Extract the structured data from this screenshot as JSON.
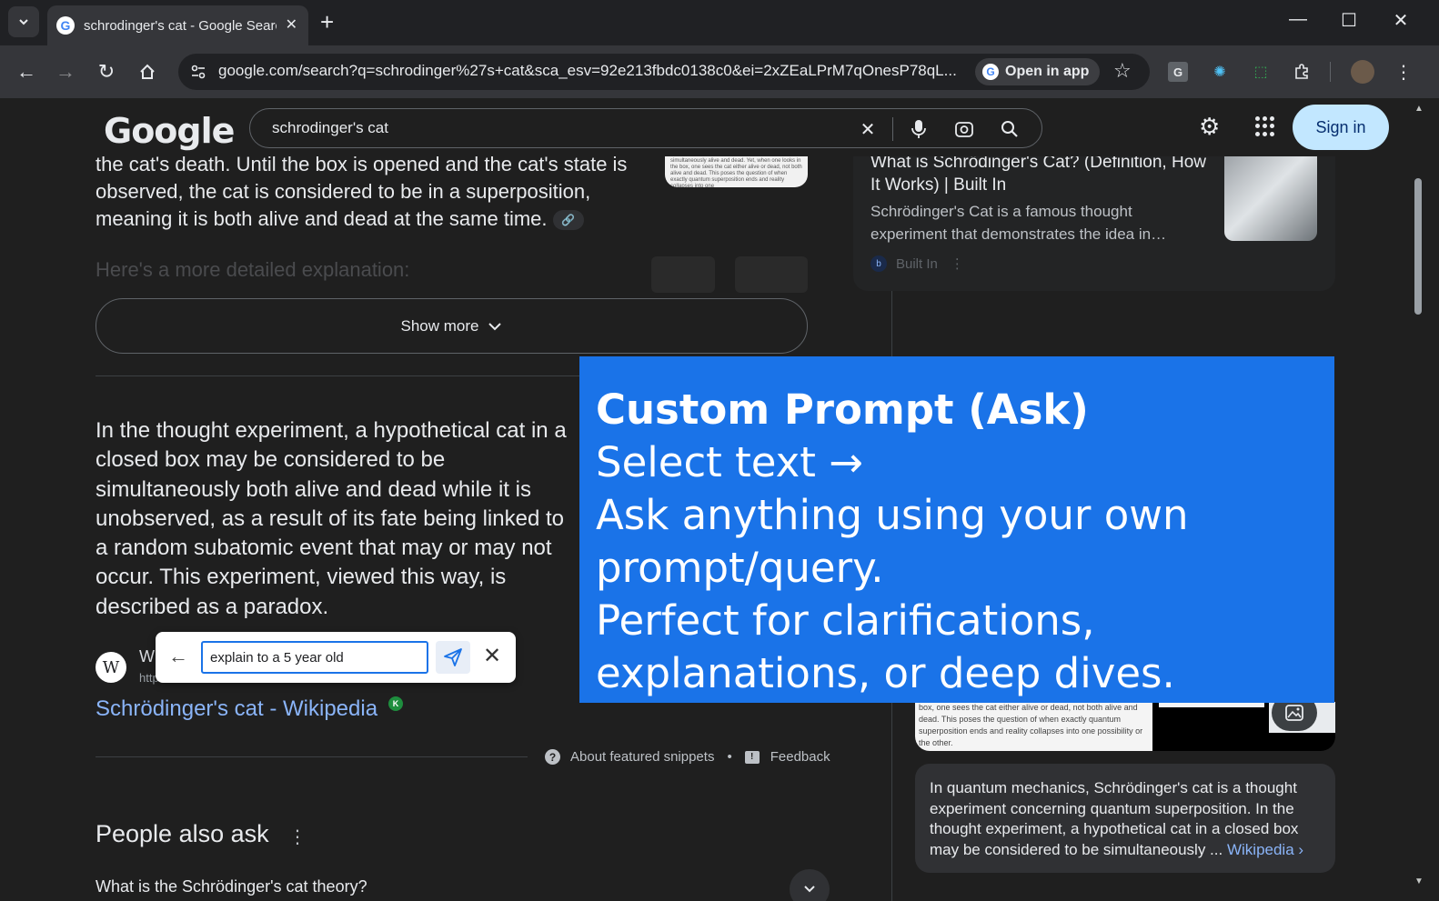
{
  "browser": {
    "tab_title": "schrodinger's cat - Google Search",
    "url": "google.com/search?q=schrodinger%27s+cat&sca_esv=92e213fbdc0138c0&ei=2xZEaLPrM7qOnesP78qL...",
    "open_in_app_label": "Open in app",
    "window_controls": {
      "minimize": "—",
      "maximize": "☐",
      "close": "✕"
    }
  },
  "google": {
    "logo": "Google",
    "query": "schrodinger's cat",
    "sign_in_label": "Sign in"
  },
  "main": {
    "snippet_top": "the cat's death. Until the box is opened and the cat's state is observed, the cat is considered to be in a superposition, meaning it is both alive and dead at the same time.",
    "detailed_heading": "Here's a more detailed explanation:",
    "thumb_text": "simultaneously alive and dead. Yet, when one looks in the box, one sees the cat either alive or dead, not both alive and dead. This poses the question of when exactly quantum superposition ends and reality collapses into one",
    "show_more_label": "Show more",
    "paragraph": "In the thought experiment, a hypothetical cat in a closed box may be considered to be simultaneously both alive and dead while it is unobserved, as a result of its fate being linked to a random subatomic event that may or may not occur. This experiment, viewed this way, is described as a paradox.",
    "source_name": "W",
    "source_url": "http",
    "source_link": "Schrödinger's cat - Wikipedia",
    "about_snippets_label": "About featured snippets",
    "feedback_label": "Feedback",
    "paa_title": "People also ask",
    "paa_first_question": "What is the Schrödinger's cat theory?"
  },
  "right": {
    "card_title": "What is Schrödinger's Cat? (Definition, How It Works) | Built In",
    "card_desc": "Schrödinger's Cat is a famous thought experiment that demonstrates the idea in…",
    "card_source": "Built In",
    "image_text": "box, one sees the cat either alive or dead, not both alive and dead. This poses the question of when exactly quantum superposition ends and reality collapses into one possibility or the other.",
    "kp_desc": "In quantum mechanics, Schrödinger's cat is a thought experiment concerning quantum superposition. In the thought experiment, a hypothetical cat in a closed box may be considered to be simultaneously ...",
    "kp_source": "Wikipedia ›"
  },
  "ask_bar": {
    "input_value": "explain to a 5 year old"
  },
  "promo": {
    "title": "Custom Prompt (Ask)",
    "line1": "Select text →",
    "line2": "Ask anything using your own",
    "line3": "prompt/query.",
    "line4": "Perfect for clarifications,",
    "line5": "explanations, or deep dives."
  },
  "colors": {
    "accent": "#1a73e8",
    "link": "#8ab4f8",
    "page_bg": "#1f1f1f",
    "sign_in_bg": "#c2e7ff"
  }
}
